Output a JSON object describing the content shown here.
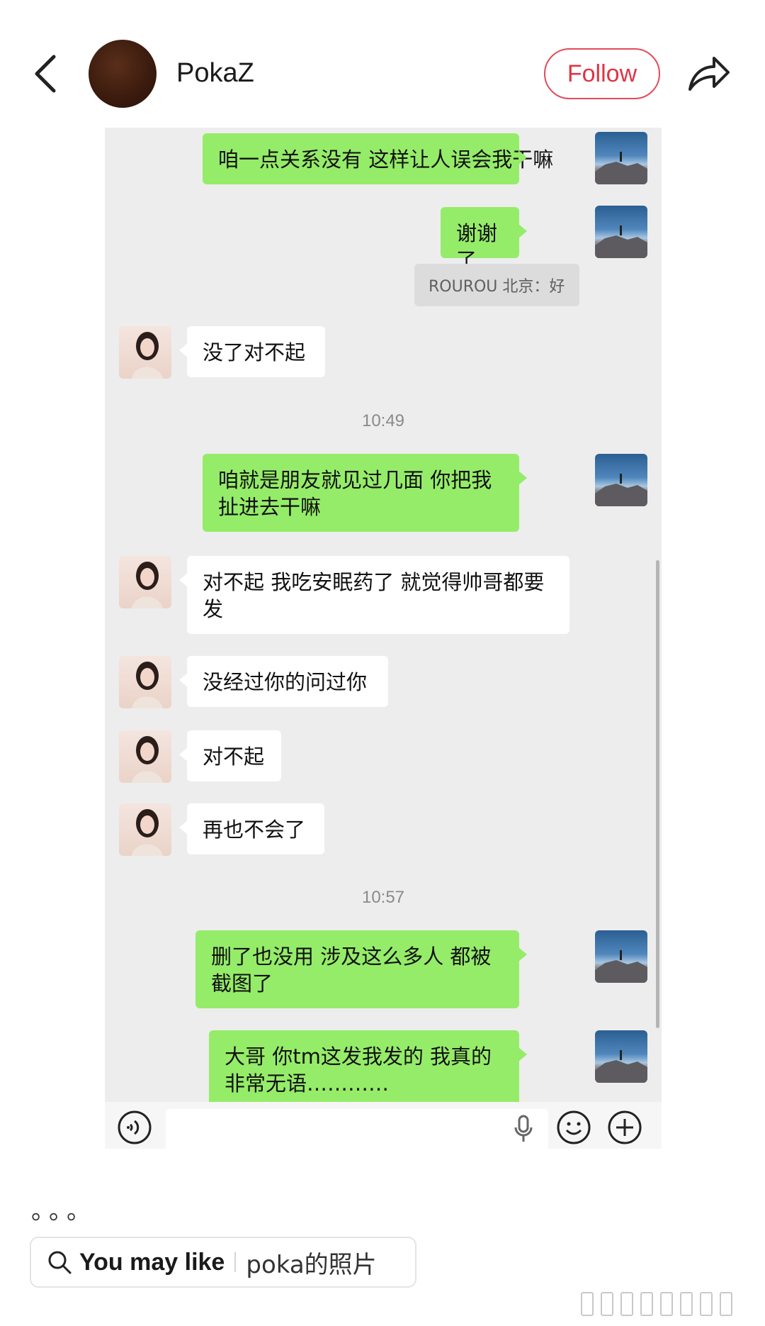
{
  "header": {
    "username": "PokaZ",
    "follow_label": "Follow"
  },
  "chat": {
    "messages": [
      {
        "side": "me",
        "text": "咱一点关系没有 这样让人误会我干嘛"
      },
      {
        "side": "me",
        "text": "谢谢了"
      },
      {
        "side": "quote",
        "text": "ROUROU 北京：好"
      },
      {
        "side": "them",
        "text": "没了对不起"
      },
      {
        "side": "time",
        "text": "10:49"
      },
      {
        "side": "me",
        "text": "咱就是朋友就见过几面 你把我扯进去干嘛"
      },
      {
        "side": "them",
        "text": "对不起 我吃安眠药了 就觉得帅哥都要发"
      },
      {
        "side": "them",
        "text": "没经过你的问过你"
      },
      {
        "side": "them",
        "text": "对不起"
      },
      {
        "side": "them",
        "text": "再也不会了"
      },
      {
        "side": "time",
        "text": "10:57"
      },
      {
        "side": "me",
        "text": "删了也没用 涉及这么多人 都被截图了"
      },
      {
        "side": "me",
        "text": "大哥 你tm这发我发的 我真的非常无语…………"
      }
    ]
  },
  "footer": {
    "dots": "。。。",
    "you_may_like_label": "You may like",
    "you_may_like_query": "poka的照片"
  },
  "icons": {
    "back": "chevron-left-icon",
    "share": "share-arrow-icon",
    "voice": "voice-icon",
    "mic": "microphone-icon",
    "emoji": "emoji-icon",
    "plus": "plus-icon",
    "search": "search-icon"
  },
  "colors": {
    "follow_red": "#e03445",
    "my_bubble": "#95ec69",
    "chat_bg": "#ededed"
  }
}
